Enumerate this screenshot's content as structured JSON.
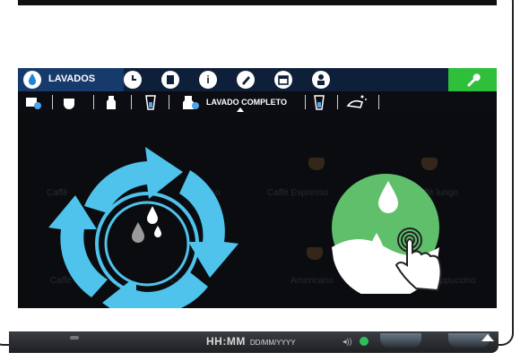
{
  "menubar": {
    "title": "LAVADOS",
    "icons": [
      "water-drop-icon",
      "clock-icon",
      "cup-icon",
      "info-icon",
      "pencil-icon",
      "calendar-icon",
      "user-icon"
    ],
    "wrench_color": "#2fbf3a"
  },
  "tabs": {
    "active_label": "LAVADO COMPLETO"
  },
  "action": {
    "rinse_circle_color": "#5fbf6a",
    "arrows_color": "#4fc3ec"
  },
  "background_menu": {
    "items": [
      "Caffè",
      "Espresso",
      "Caffè Espresso",
      "Caffè lungo",
      "Caffè",
      "Caffè",
      "Americano",
      "Cappuccino"
    ]
  },
  "status": {
    "time": "HH:MM",
    "date": "DD/MM/YYYY"
  }
}
